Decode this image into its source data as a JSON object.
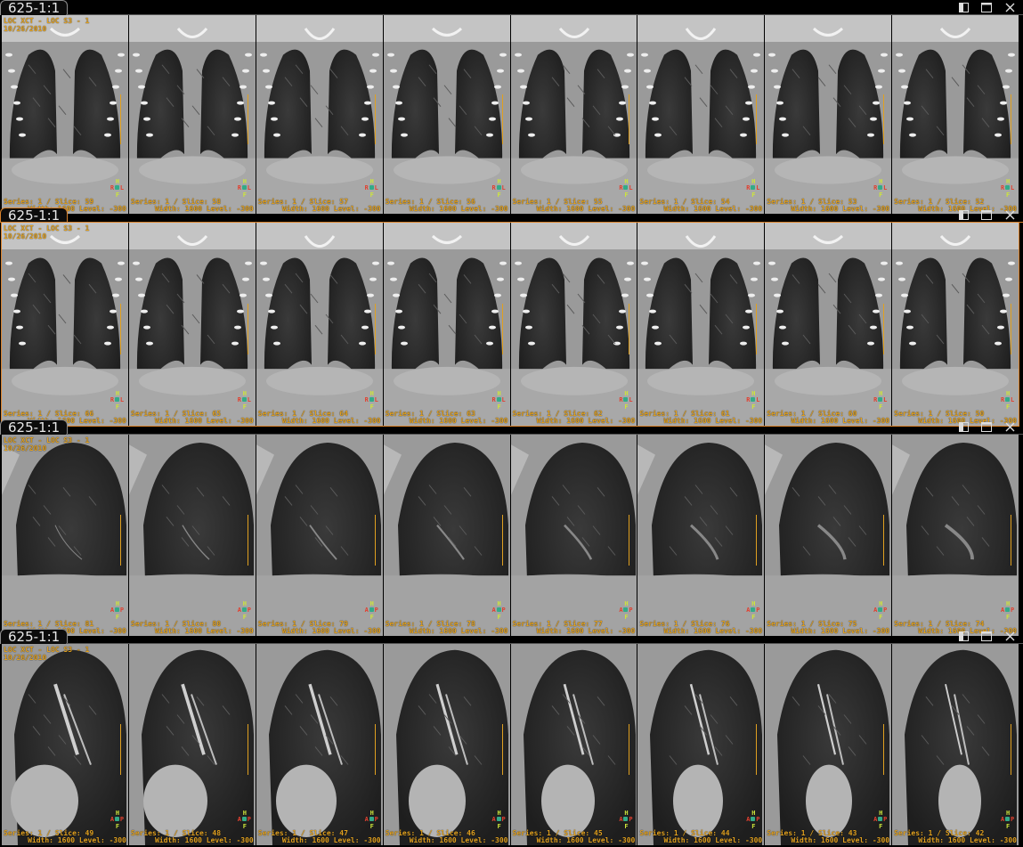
{
  "panels": [
    {
      "tab": "625-1:1",
      "active": false,
      "view": "coronal",
      "orientation": {
        "top": "H",
        "bottom": "F",
        "left": "R",
        "right": "L"
      },
      "tiles": [
        {
          "series": "Series: 1 / Slice: 59",
          "wl": "Width: 1600 Level: -300",
          "study": "LOC XCT - LOC S3 - 1",
          "date": "10/26/2010",
          "selected": true
        },
        {
          "series": "Series: 1 / Slice: 58",
          "wl": "Width: 1600 Level: -300"
        },
        {
          "series": "Series: 1 / Slice: 57",
          "wl": "Width: 1600 Level: -300"
        },
        {
          "series": "Series: 1 / Slice: 56",
          "wl": "Width: 1600 Level: -300"
        },
        {
          "series": "Series: 1 / Slice: 55",
          "wl": "Width: 1600 Level: -300"
        },
        {
          "series": "Series: 1 / Slice: 54",
          "wl": "Width: 1600 Level: -300"
        },
        {
          "series": "Series: 1 / Slice: 53",
          "wl": "Width: 1600 Level: -300"
        },
        {
          "series": "Series: 1 / Slice: 52",
          "wl": "Width: 1600 Level: -300"
        }
      ]
    },
    {
      "tab": "625-1:1",
      "active": true,
      "view": "coronal",
      "orientation": {
        "top": "H",
        "bottom": "F",
        "left": "R",
        "right": "L"
      },
      "tiles": [
        {
          "series": "Series: 1 / Slice: 66",
          "wl": "Width: 1600 Level: -300",
          "study": "LOC XCT - LOC S3 - 1",
          "date": "10/26/2010"
        },
        {
          "series": "Series: 1 / Slice: 65",
          "wl": "Width: 1600 Level: -300"
        },
        {
          "series": "Series: 1 / Slice: 64",
          "wl": "Width: 1600 Level: -300"
        },
        {
          "series": "Series: 1 / Slice: 63",
          "wl": "Width: 1600 Level: -300"
        },
        {
          "series": "Series: 1 / Slice: 62",
          "wl": "Width: 1600 Level: -300"
        },
        {
          "series": "Series: 1 / Slice: 61",
          "wl": "Width: 1600 Level: -300"
        },
        {
          "series": "Series: 1 / Slice: 60",
          "wl": "Width: 1600 Level: -300"
        },
        {
          "series": "Series: 1 / Slice: 50",
          "wl": "Width: 1600 Level: -300",
          "selected": true
        }
      ]
    },
    {
      "tab": "625-1:1",
      "active": false,
      "view": "sagittal",
      "orientation": {
        "top": "H",
        "bottom": "F",
        "left": "A",
        "right": "P"
      },
      "tiles": [
        {
          "series": "Series: 1 / Slice: 81",
          "wl": "Width: 1600 Level: -300",
          "study": "LOC XCT - LOC S3 - 1",
          "date": "10/26/2010",
          "selected": true
        },
        {
          "series": "Series: 1 / Slice: 80",
          "wl": "Width: 1600 Level: -300"
        },
        {
          "series": "Series: 1 / Slice: 79",
          "wl": "Width: 1600 Level: -300"
        },
        {
          "series": "Series: 1 / Slice: 78",
          "wl": "Width: 1600 Level: -300"
        },
        {
          "series": "Series: 1 / Slice: 77",
          "wl": "Width: 1600 Level: -300"
        },
        {
          "series": "Series: 1 / Slice: 76",
          "wl": "Width: 1600 Level: -300"
        },
        {
          "series": "Series: 1 / Slice: 75",
          "wl": "Width: 1600 Level: -300"
        },
        {
          "series": "Series: 1 / Slice: 74",
          "wl": "Width: 1600 Level: -300"
        }
      ]
    },
    {
      "tab": "625-1:1",
      "active": false,
      "view": "sagittal-heart",
      "orientation": {
        "top": "H",
        "bottom": "F",
        "left": "A",
        "right": "P"
      },
      "tiles": [
        {
          "series": "Series: 1 / Slice: 49",
          "wl": "Width: 1600 Level: -300",
          "study": "LOC XCT - LOC S3 - 1",
          "date": "10/26/2010",
          "selected": true
        },
        {
          "series": "Series: 1 / Slice: 48",
          "wl": "Width: 1600 Level: -300"
        },
        {
          "series": "Series: 1 / Slice: 47",
          "wl": "Width: 1600 Level: -300"
        },
        {
          "series": "Series: 1 / Slice: 46",
          "wl": "Width: 1600 Level: -300"
        },
        {
          "series": "Series: 1 / Slice: 45",
          "wl": "Width: 1600 Level: -300"
        },
        {
          "series": "Series: 1 / Slice: 44",
          "wl": "Width: 1600 Level: -300"
        },
        {
          "series": "Series: 1 / Slice: 43",
          "wl": "Width: 1600 Level: -300"
        },
        {
          "series": "Series: 1 / Slice: 42",
          "wl": "Width: 1600 Level: -300"
        }
      ]
    }
  ],
  "colors": {
    "overlay": "#e0a020",
    "active_border": "#d9822b",
    "selected_border": "#4a7fd6"
  },
  "icons": [
    "layout-icon",
    "maximize-icon",
    "close-icon"
  ]
}
